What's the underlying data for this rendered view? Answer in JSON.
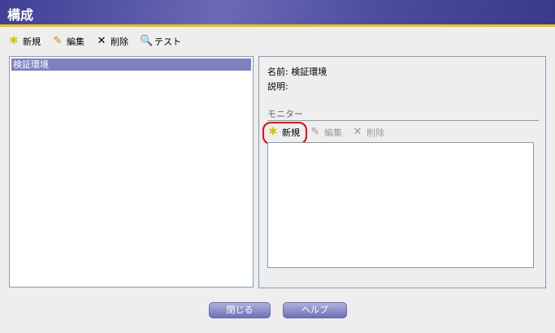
{
  "title": "構成",
  "toolbar": {
    "new": "新規",
    "edit": "編集",
    "delete": "削除",
    "test": "テスト"
  },
  "list": {
    "items": [
      "検証環境"
    ]
  },
  "details": {
    "name_label": "名前:",
    "name_value": "検証環境",
    "desc_label": "説明:",
    "monitor_header": "モニター",
    "monitor_toolbar": {
      "new": "新規",
      "edit": "編集",
      "delete": "削除"
    }
  },
  "buttons": {
    "close": "閉じる",
    "help": "ヘルプ"
  }
}
